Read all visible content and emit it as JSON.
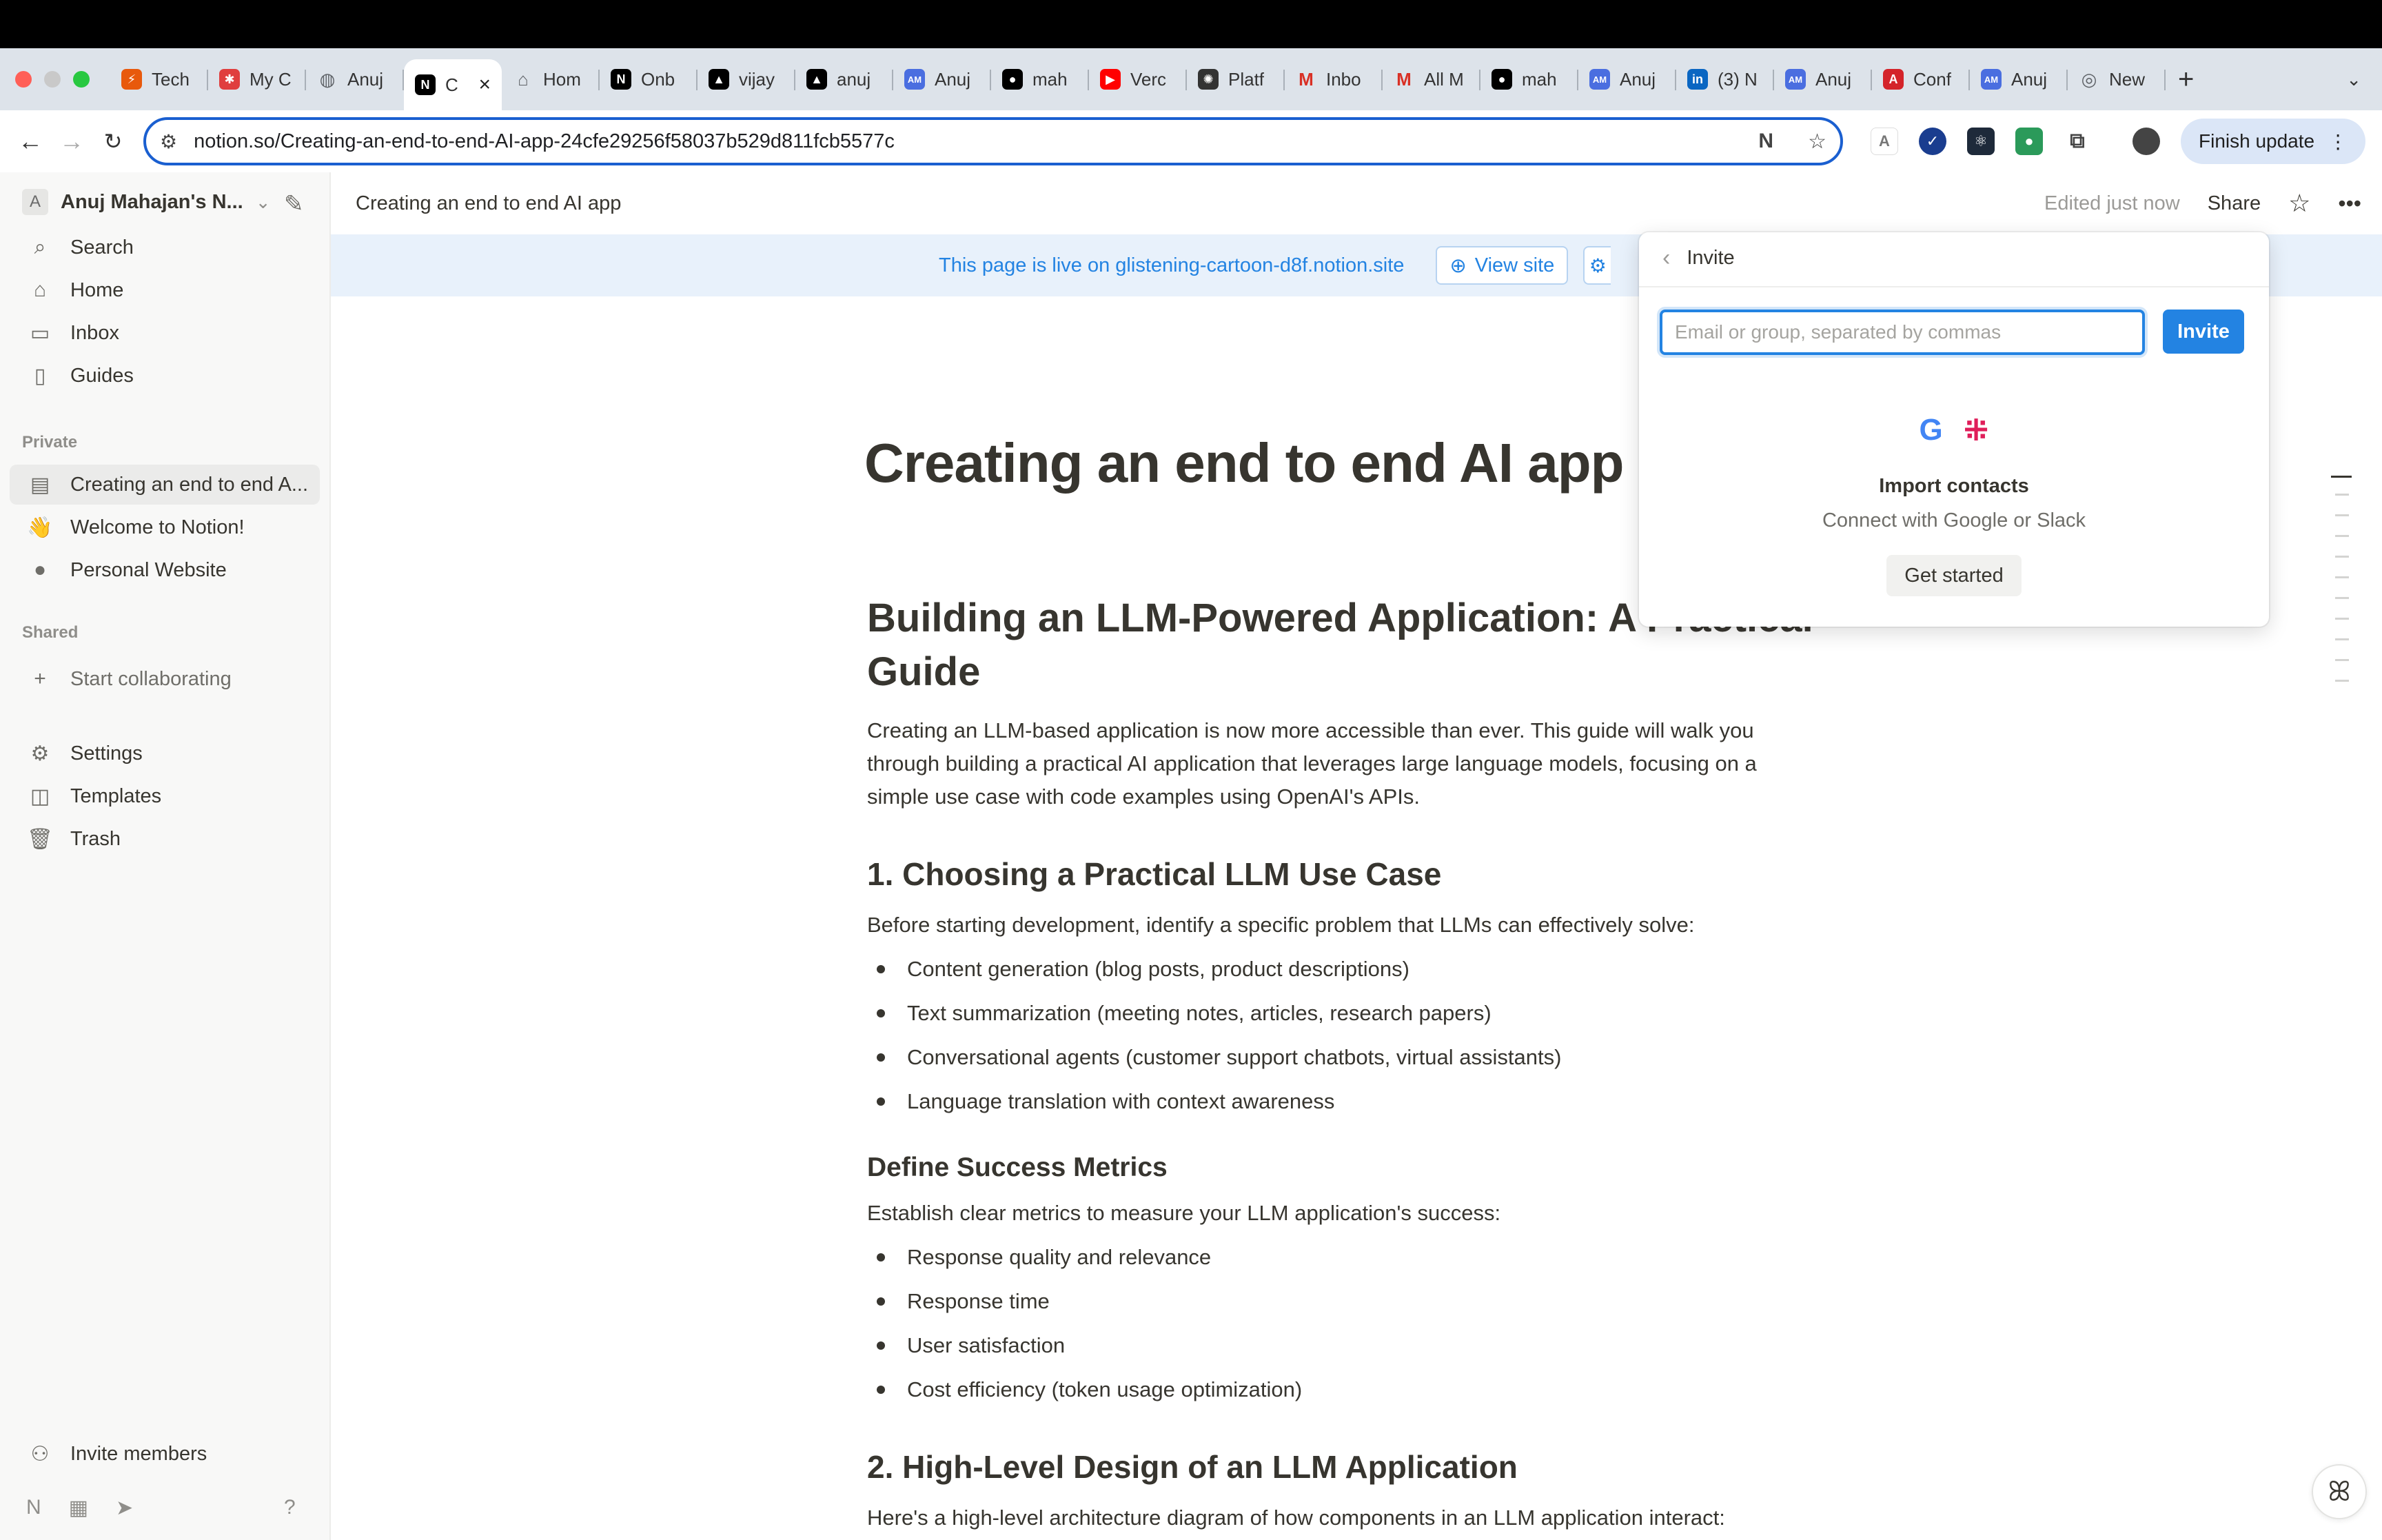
{
  "browser": {
    "tabs": [
      {
        "label": "Tech",
        "icon": "bolt-favicon",
        "color": "#e8590c"
      },
      {
        "label": "My C",
        "icon": "shapes-favicon",
        "color": "#e03e3e"
      },
      {
        "label": "Anuj",
        "icon": "globe-favicon",
        "color": "#5f6368"
      },
      {
        "label": "C",
        "icon": "notion-favicon",
        "color": "#000000",
        "active": true
      },
      {
        "label": "Hom",
        "icon": "home-favicon",
        "color": "#5f6368"
      },
      {
        "label": "Onb",
        "icon": "notion-favicon",
        "color": "#000000"
      },
      {
        "label": "vijay",
        "icon": "vercel-favicon",
        "color": "#000000"
      },
      {
        "label": "anuj",
        "icon": "vercel-favicon",
        "color": "#000000"
      },
      {
        "label": "Anuj",
        "icon": "am-favicon",
        "color": "#4a6ee0"
      },
      {
        "label": "mah",
        "icon": "github-favicon",
        "color": "#000000"
      },
      {
        "label": "Verc",
        "icon": "youtube-favicon",
        "color": "#ff0000"
      },
      {
        "label": "Platf",
        "icon": "openai-favicon",
        "color": "#333333"
      },
      {
        "label": "Inbo",
        "icon": "gmail-favicon",
        "color": "#d93025"
      },
      {
        "label": "All M",
        "icon": "gmail-favicon",
        "color": "#d93025"
      },
      {
        "label": "mah",
        "icon": "github-favicon",
        "color": "#000000"
      },
      {
        "label": "Anuj",
        "icon": "am-favicon",
        "color": "#4a6ee0"
      },
      {
        "label": "(3) N",
        "icon": "linkedin-favicon",
        "color": "#0a66c2"
      },
      {
        "label": "Anuj",
        "icon": "am-favicon",
        "color": "#4a6ee0"
      },
      {
        "label": "Conf",
        "icon": "acrobat-favicon",
        "color": "#d4242a"
      },
      {
        "label": "Anuj",
        "icon": "am-favicon",
        "color": "#4a6ee0"
      },
      {
        "label": "New",
        "icon": "chrome-favicon",
        "color": "#5f6368"
      }
    ],
    "url": "notion.so/Creating-an-end-to-end-AI-app-24cfe29256f58037b529d811fcb5577c",
    "finish_update": "Finish update"
  },
  "sidebar": {
    "workspace_initial": "A",
    "workspace_name": "Anuj Mahajan's N...",
    "nav": [
      {
        "label": "Search",
        "icon": "search-icon"
      },
      {
        "label": "Home",
        "icon": "home-icon"
      },
      {
        "label": "Inbox",
        "icon": "inbox-icon"
      },
      {
        "label": "Guides",
        "icon": "book-icon"
      }
    ],
    "private_label": "Private",
    "private_pages": [
      {
        "label": "Creating an end to end A...",
        "icon": "page-icon",
        "selected": true
      },
      {
        "label": "Welcome to Notion!",
        "icon": "wave-icon"
      },
      {
        "label": "Personal Website",
        "icon": "person-icon"
      }
    ],
    "shared_label": "Shared",
    "start_collaborating": "Start collaborating",
    "footer_nav": [
      {
        "label": "Settings",
        "icon": "gear-icon"
      },
      {
        "label": "Templates",
        "icon": "templates-icon"
      },
      {
        "label": "Trash",
        "icon": "trash-icon"
      }
    ],
    "invite_members": "Invite members"
  },
  "header": {
    "breadcrumb": "Creating an end to end AI app",
    "edited": "Edited just now",
    "share": "Share"
  },
  "banner": {
    "text": "This page is live on glistening-cartoon-d8f.notion.site",
    "view_site": "View site"
  },
  "content": {
    "title": "Creating an end to end AI app",
    "h2_line1": "Building an LLM-Powered Application: A Practical",
    "h2_line2": "Guide",
    "intro": [
      "Creating an LLM-based application is now more accessible than ever. This guide will walk you",
      "through building a practical AI application that leverages large language models, focusing on a",
      "simple use case with code examples using OpenAI's APIs."
    ],
    "section1": "1. Choosing a Practical LLM Use Case",
    "section1_intro": "Before starting development, identify a specific problem that LLMs can effectively solve:",
    "section1_bullets": [
      "Content generation (blog posts, product descriptions)",
      "Text summarization (meeting notes, articles, research papers)",
      "Conversational agents (customer support chatbots, virtual assistants)",
      "Language translation with context awareness"
    ],
    "metrics_heading": "Define Success Metrics",
    "metrics_intro": "Establish clear metrics to measure your LLM application's success:",
    "metrics_bullets": [
      "Response quality and relevance",
      "Response time",
      "User satisfaction",
      "Cost efficiency (token usage optimization)"
    ],
    "section2": "2. High-Level Design of an LLM Application",
    "section2_intro": "Here's a high-level architecture diagram of how components in an LLM application interact:"
  },
  "invite": {
    "title": "Invite",
    "placeholder": "Email or group, separated by commas",
    "button": "Invite",
    "import_title": "Import contacts",
    "import_sub": "Connect with Google or Slack",
    "get_started": "Get started"
  },
  "colors": {
    "accent": "#2383e2",
    "banner_bg": "#e8f1fb",
    "sidebar_bg": "#f8f8f7"
  }
}
